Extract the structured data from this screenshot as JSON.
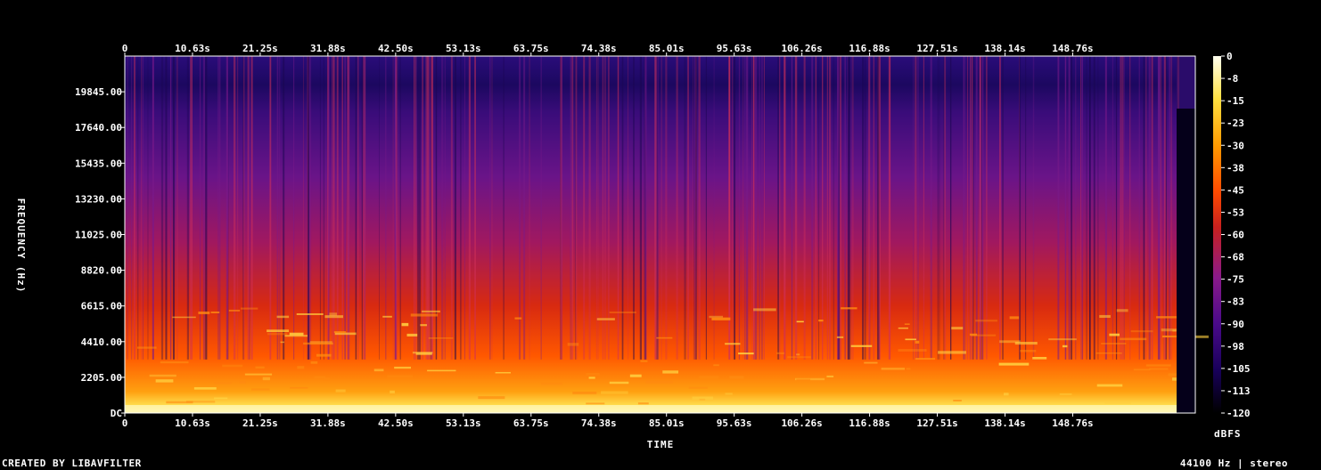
{
  "chart_data": {
    "type": "heatmap",
    "xlabel": "TIME",
    "ylabel": "FREQUENCY (Hz)",
    "x_ticks": [
      "0",
      "10.63s",
      "21.25s",
      "31.88s",
      "42.50s",
      "53.13s",
      "63.75s",
      "74.38s",
      "85.01s",
      "95.63s",
      "106.26s",
      "116.88s",
      "127.51s",
      "138.14s",
      "148.76s"
    ],
    "y_ticks": [
      "DC",
      "2205.00",
      "4410.00",
      "6615.00",
      "8820.00",
      "11025.00",
      "13230.00",
      "15435.00",
      "17640.00",
      "19845.00"
    ],
    "y_tick_values": [
      0,
      2205,
      4410,
      6615,
      8820,
      11025,
      13230,
      15435,
      17640,
      19845
    ],
    "y_max": 22050,
    "x_max": 168,
    "audio_end": 167,
    "colorbar_label": "dBFS",
    "colorbar_ticks": [
      "0",
      "-8",
      "-15",
      "-23",
      "-30",
      "-38",
      "-45",
      "-53",
      "-60",
      "-68",
      "-75",
      "-83",
      "-90",
      "-98",
      "-105",
      "-113",
      "-120"
    ],
    "colorbar_range": [
      -120,
      0
    ],
    "colormap": [
      "#000000",
      "#18005a",
      "#4a0a8a",
      "#8a1a8a",
      "#c8201e",
      "#ff4a00",
      "#ff9a00",
      "#ffe040",
      "#fffff0"
    ]
  },
  "footer": {
    "credit": "CREATED BY LIBAVFILTER",
    "format": "44100 Hz | stereo"
  }
}
